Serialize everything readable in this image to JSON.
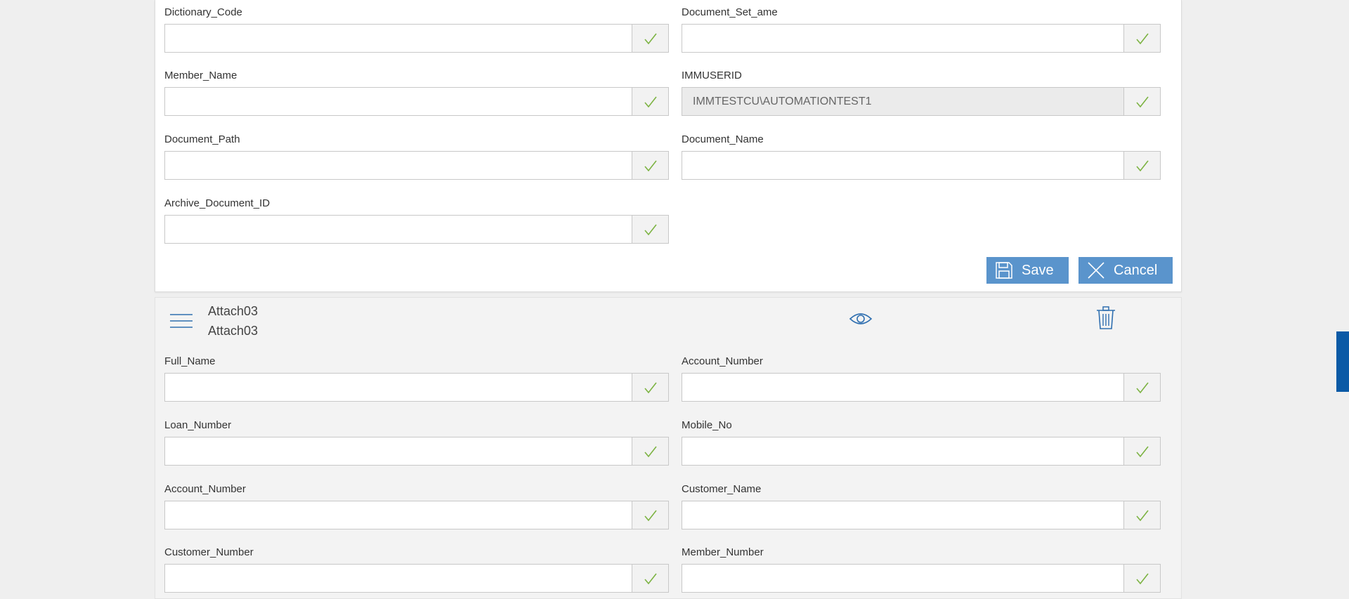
{
  "top_form": {
    "fields": [
      {
        "label": "Dictionary_Code",
        "value": ""
      },
      {
        "label": "Document_Set_ame",
        "value": ""
      },
      {
        "label": "Member_Name",
        "value": ""
      },
      {
        "label": "IMMUSERID",
        "value": "IMMTESTCU\\AUTOMATIONTEST1"
      },
      {
        "label": "Document_Path",
        "value": ""
      },
      {
        "label": "Document_Name",
        "value": ""
      },
      {
        "label": "Archive_Document_ID",
        "value": ""
      }
    ],
    "save_label": "Save",
    "cancel_label": "Cancel"
  },
  "attachment": {
    "title": "Attach03",
    "subtitle": "Attach03",
    "fields": [
      {
        "label": "Full_Name",
        "value": ""
      },
      {
        "label": "Account_Number",
        "value": ""
      },
      {
        "label": "Loan_Number",
        "value": ""
      },
      {
        "label": "Mobile_No",
        "value": ""
      },
      {
        "label": "Account_Number",
        "value": ""
      },
      {
        "label": "Customer_Name",
        "value": ""
      },
      {
        "label": "Customer_Number",
        "value": ""
      },
      {
        "label": "Member_Number",
        "value": ""
      }
    ]
  },
  "icons": {
    "check": "check-icon",
    "save": "save-icon",
    "cancel": "close-icon",
    "menu": "hamburger-menu-icon",
    "view": "eye-icon",
    "delete": "trash-icon"
  },
  "colors": {
    "button": "#5a94cc",
    "icon_blue": "#2f6fb0",
    "check_green": "#7cb342",
    "side_tab": "#0b5aa6"
  }
}
